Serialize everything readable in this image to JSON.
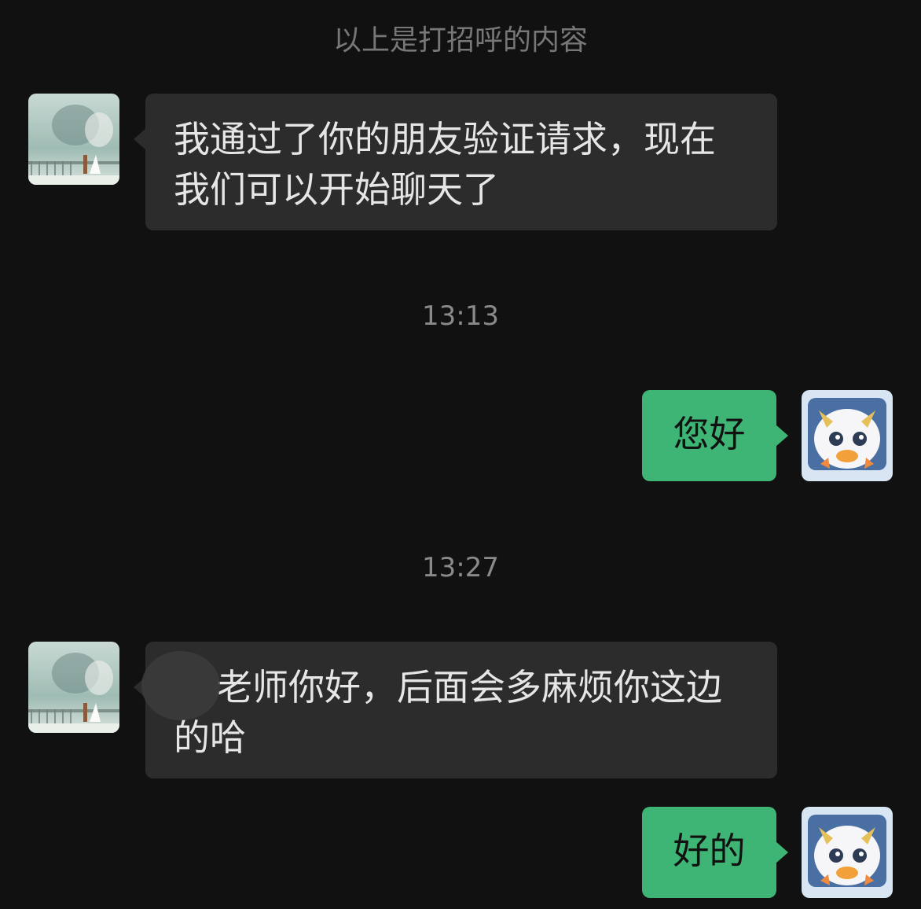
{
  "system_note": "以上是打招呼的内容",
  "messages": [
    {
      "sender": "contact",
      "text": "我通过了你的朋友验证请求，现在我们可以开始聊天了"
    },
    {
      "timestamp": "13:13"
    },
    {
      "sender": "me",
      "text": "您好"
    },
    {
      "timestamp": "13:27"
    },
    {
      "sender": "contact",
      "text": "老师你好，后面会多麻烦你这边的哈"
    },
    {
      "sender": "me",
      "text": "好的"
    }
  ],
  "colors": {
    "background": "#111111",
    "incoming_bubble": "#2c2c2c",
    "outgoing_bubble": "#3eb575"
  },
  "icons": {
    "contact_avatar": "wedding-photo-avatar",
    "my_avatar": "cartoon-creature-avatar"
  }
}
